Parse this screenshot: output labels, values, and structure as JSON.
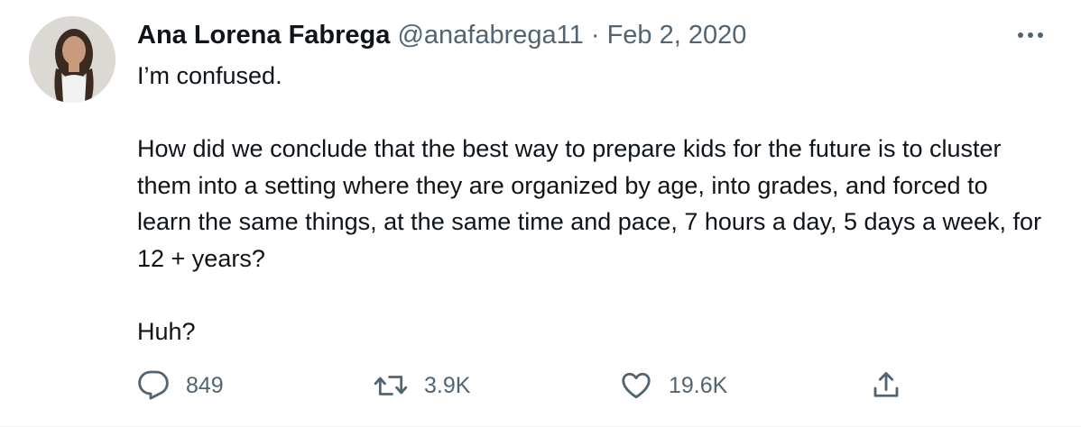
{
  "tweet": {
    "author": {
      "name": "Ana Lorena Fabrega",
      "handle": "@anafabrega11"
    },
    "separator": "·",
    "date": "Feb 2, 2020",
    "paragraphs": [
      "I’m confused.",
      "How did we conclude that the best way to prepare kids for the future is to cluster them into a setting where they are organized by age, into grades, and forced to learn the same things, at the same time and pace, 7 hours a day, 5 days a week, for 12 + years?",
      "Huh?"
    ],
    "stats": {
      "replies": "849",
      "retweets": "3.9K",
      "likes": "19.6K"
    }
  },
  "icons": {
    "more": "more-horizontal-icon",
    "reply": "reply-bubble-icon",
    "retweet": "retweet-icon",
    "like": "heart-icon",
    "share": "share-upload-icon"
  },
  "colors": {
    "text_primary": "#0f1419",
    "text_secondary": "#536471",
    "background": "#ffffff"
  }
}
